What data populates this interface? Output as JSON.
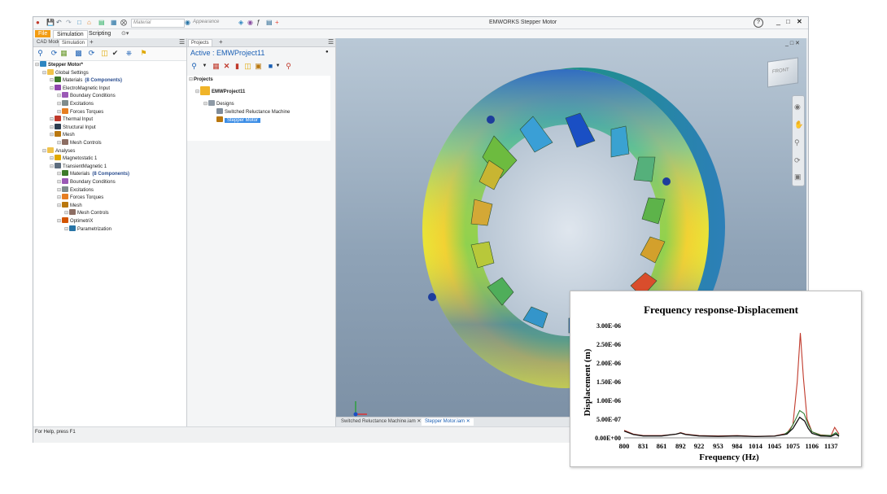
{
  "titlebar": {
    "material_placeholder": "Material",
    "appearance_placeholder": "Appearance",
    "window_title": "EMWORKS  Stepper Motor",
    "help_label": "?",
    "minimize": "_",
    "maximize": "□",
    "close": "✕"
  },
  "ribbon": {
    "tabs": [
      "File",
      "Simulation",
      "Scripting"
    ]
  },
  "left_panel": {
    "tabs": [
      "CAD Model",
      "Simulation"
    ],
    "add_tab": "+"
  },
  "tree": [
    {
      "label": "Stepper Motor*",
      "level": 0,
      "icon": "motor-icon"
    },
    {
      "label": "Global Settings",
      "level": 1,
      "icon": "folder-icon"
    },
    {
      "label": "Materials",
      "count": "(8 Components)",
      "level": 2,
      "icon": "materials-icon"
    },
    {
      "label": "ElectroMagnetic Input",
      "level": 2,
      "icon": "electromagnetic-icon"
    },
    {
      "label": "Boundary Conditions",
      "level": 3,
      "icon": "boundary-icon"
    },
    {
      "label": "Excitations",
      "level": 3,
      "icon": "excitations-icon"
    },
    {
      "label": "Forces Torques",
      "level": 3,
      "icon": "forces-icon"
    },
    {
      "label": "Thermal Input",
      "level": 2,
      "icon": "thermal-icon"
    },
    {
      "label": "Structural Input",
      "level": 2,
      "icon": "structural-icon"
    },
    {
      "label": "Mesh",
      "level": 2,
      "icon": "mesh-icon"
    },
    {
      "label": "Mesh Controls",
      "level": 3,
      "icon": "mesh-controls-icon"
    },
    {
      "label": "Analyses",
      "level": 1,
      "icon": "folder-icon"
    },
    {
      "label": "Magnetostatic 1",
      "level": 2,
      "icon": "magnetostatic-icon"
    },
    {
      "label": "TransientMagnetic 1",
      "level": 2,
      "icon": "transient-icon"
    },
    {
      "label": "Materials",
      "count": "(8 Components)",
      "level": 3,
      "icon": "materials-icon"
    },
    {
      "label": "Boundary Conditions",
      "level": 3,
      "icon": "boundary-icon"
    },
    {
      "label": "Excitations",
      "level": 3,
      "icon": "excitations-icon"
    },
    {
      "label": "Forces Torques",
      "level": 3,
      "icon": "forces-icon"
    },
    {
      "label": "Mesh",
      "level": 3,
      "icon": "mesh-icon"
    },
    {
      "label": "Mesh Controls",
      "level": 4,
      "icon": "mesh-controls-icon"
    },
    {
      "label": "OptimetriX",
      "level": 3,
      "icon": "optimetrix-icon"
    },
    {
      "label": "Parametrization",
      "level": 4,
      "icon": "parametrization-icon"
    }
  ],
  "projects_panel": {
    "tab": "Projects",
    "add_tab": "+",
    "active_label": "Active : EMWProject11",
    "root": "Projects",
    "project": "EMWProject11",
    "designs": "Designs",
    "design_items": [
      "Switched Reluctance Machine",
      "Stepper Motor"
    ]
  },
  "viewcube_label": "FRONT",
  "doc_tabs": [
    "Switched Reluctance Machine.iam",
    "Stepper Motor.iam"
  ],
  "status": {
    "text": "For Help, press F1"
  },
  "chart_data": {
    "type": "line",
    "title": "Frequency response-Displacement",
    "xlabel": "Frequency  (Hz)",
    "ylabel": "Displacement (m)",
    "x_ticks": [
      "800",
      "831",
      "861",
      "892",
      "922",
      "953",
      "984",
      "1014",
      "1045",
      "1075",
      "1106",
      "1137"
    ],
    "y_ticks": [
      "0.00E+00",
      "5.00E-07",
      "1.00E-06",
      "1.50E-06",
      "2.00E-06",
      "2.50E-06",
      "3.00E-06"
    ],
    "xlim": [
      800,
      1150
    ],
    "ylim": [
      0,
      3e-06
    ],
    "grid": false,
    "colors": {
      "red": "#c0392b",
      "green": "#2e7d32",
      "black": "#111111",
      "brown": "#5d3a1a"
    },
    "series": [
      {
        "color": "red",
        "points": [
          [
            800,
            2e-07
          ],
          [
            815,
            1e-07
          ],
          [
            831,
            6e-08
          ],
          [
            861,
            6e-08
          ],
          [
            885,
            1e-07
          ],
          [
            892,
            1.4e-07
          ],
          [
            900,
            1e-07
          ],
          [
            922,
            6e-08
          ],
          [
            953,
            5e-08
          ],
          [
            984,
            6e-08
          ],
          [
            1014,
            4e-08
          ],
          [
            1045,
            5e-08
          ],
          [
            1065,
            1.2e-07
          ],
          [
            1075,
            3.5e-07
          ],
          [
            1082,
            1.5e-06
          ],
          [
            1087,
            2.8e-06
          ],
          [
            1092,
            1.6e-06
          ],
          [
            1098,
            5e-07
          ],
          [
            1106,
            1.6e-07
          ],
          [
            1120,
            8e-08
          ],
          [
            1137,
            6e-08
          ],
          [
            1143,
            2.8e-07
          ],
          [
            1150,
            1e-07
          ]
        ]
      },
      {
        "color": "green",
        "points": [
          [
            1060,
            8e-08
          ],
          [
            1070,
            2e-07
          ],
          [
            1078,
            4.5e-07
          ],
          [
            1086,
            7.3e-07
          ],
          [
            1093,
            6.5e-07
          ],
          [
            1100,
            3.5e-07
          ],
          [
            1106,
            1.6e-07
          ],
          [
            1120,
            7e-08
          ],
          [
            1137,
            6e-08
          ],
          [
            1145,
            1.4e-07
          ],
          [
            1150,
            6e-08
          ]
        ]
      },
      {
        "color": "black",
        "points": [
          [
            800,
            1.8e-07
          ],
          [
            815,
            9e-08
          ],
          [
            831,
            5e-08
          ],
          [
            861,
            5e-08
          ],
          [
            885,
            1e-07
          ],
          [
            892,
            1.3e-07
          ],
          [
            900,
            9e-08
          ],
          [
            922,
            5e-08
          ],
          [
            953,
            4e-08
          ],
          [
            984,
            5e-08
          ],
          [
            1014,
            3.5e-08
          ],
          [
            1045,
            4.5e-08
          ],
          [
            1065,
            1e-07
          ],
          [
            1075,
            2.5e-07
          ],
          [
            1086,
            5.5e-07
          ],
          [
            1094,
            4.5e-07
          ],
          [
            1100,
            2.5e-07
          ],
          [
            1106,
            1.2e-07
          ],
          [
            1120,
            5e-08
          ],
          [
            1137,
            4e-08
          ],
          [
            1145,
            1e-07
          ],
          [
            1150,
            4e-08
          ]
        ]
      }
    ]
  }
}
